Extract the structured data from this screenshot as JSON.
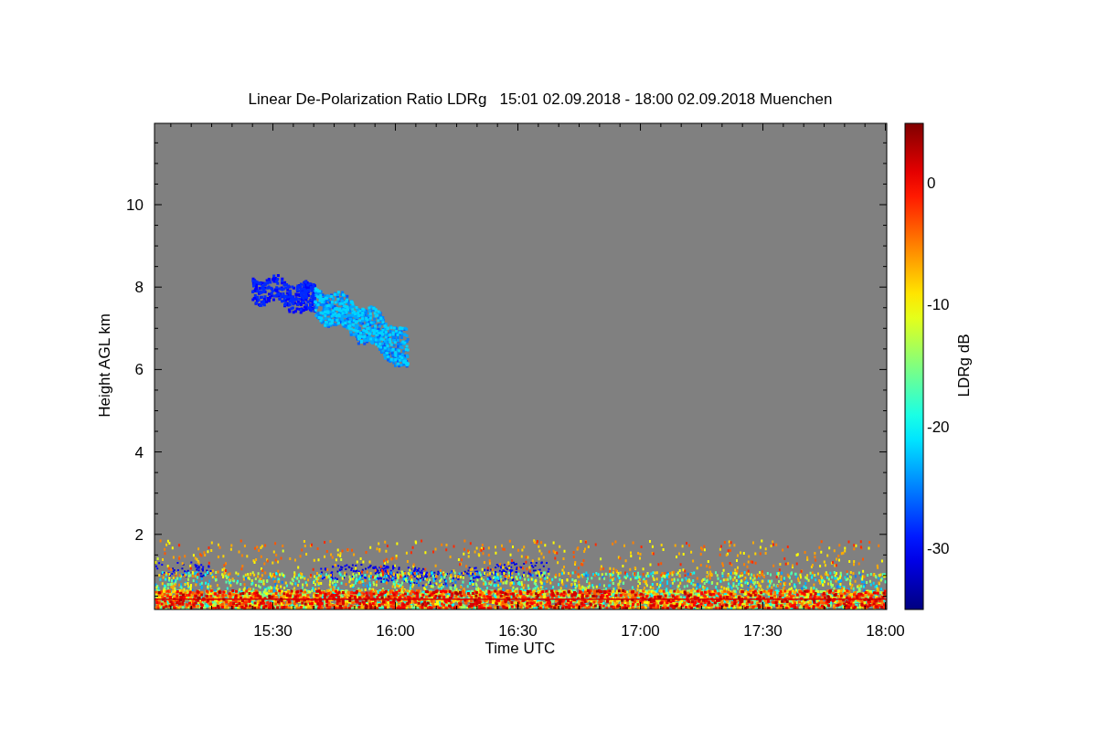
{
  "plot": {
    "title": "Linear De-Polarization Ratio LDRg   15:01 02.09.2018 - 18:00 02.09.2018 Muenchen",
    "x_axis": {
      "label": "Time UTC",
      "ticks": [
        "15:30",
        "16:00",
        "16:30",
        "17:00",
        "17:30",
        "18:00"
      ]
    },
    "y_axis": {
      "label": "Height AGL km",
      "ticks": [
        "10",
        "8",
        "6",
        "4",
        "2"
      ]
    },
    "colorbar": {
      "label": "LDRg dB",
      "ticks": [
        "0",
        "-10",
        "-20",
        "-30"
      ]
    }
  }
}
